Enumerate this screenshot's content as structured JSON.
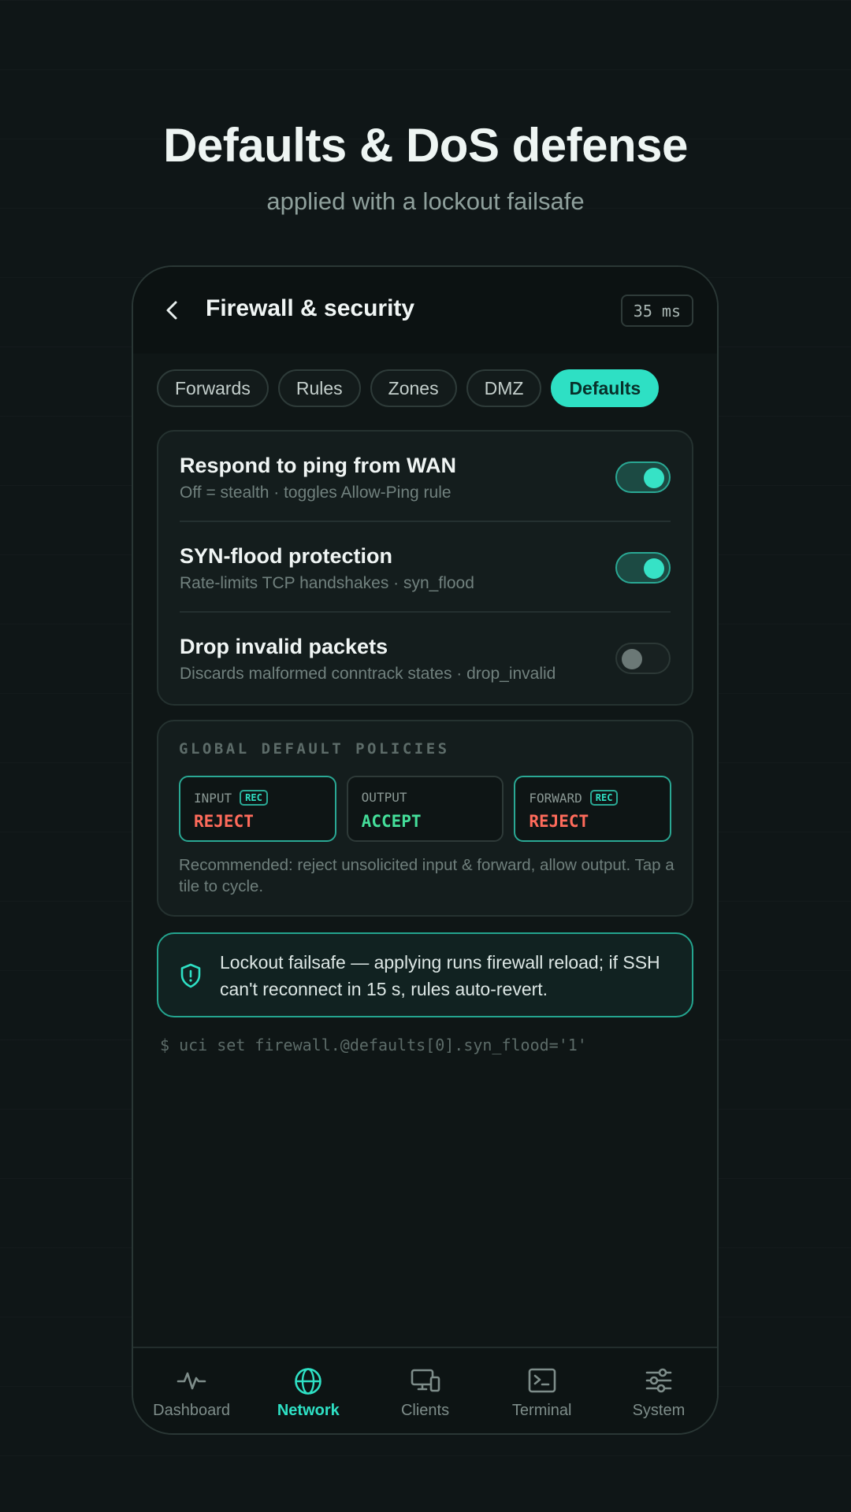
{
  "hero": {
    "title": "Defaults & DoS defense",
    "subtitle": "applied with a lockout failsafe"
  },
  "appbar": {
    "back_icon": "chevron-left-icon",
    "title": "Firewall & security",
    "latency": "35 ms"
  },
  "tabs": [
    {
      "label": "Forwards",
      "active": false
    },
    {
      "label": "Rules",
      "active": false
    },
    {
      "label": "Zones",
      "active": false
    },
    {
      "label": "DMZ",
      "active": false
    },
    {
      "label": "Defaults",
      "active": true
    }
  ],
  "toggles": [
    {
      "title": "Respond to ping from WAN",
      "subtitle": "Off = stealth · toggles Allow-Ping rule",
      "on": true
    },
    {
      "title": "SYN-flood protection",
      "subtitle": "Rate-limits TCP handshakes · syn_flood",
      "on": true
    },
    {
      "title": "Drop invalid packets",
      "subtitle": "Discards malformed conntrack states · drop_invalid",
      "on": false
    }
  ],
  "policies": {
    "title": "GLOBAL DEFAULT POLICIES",
    "tiles": [
      {
        "label": "INPUT",
        "badge": "REC",
        "value": "REJECT"
      },
      {
        "label": "OUTPUT",
        "badge": "",
        "value": "ACCEPT"
      },
      {
        "label": "FORWARD",
        "badge": "REC",
        "value": "REJECT"
      }
    ],
    "note": "Recommended: reject unsolicited input & forward, allow output. Tap a tile to cycle."
  },
  "failsafe": {
    "icon": "shield-alert-icon",
    "text": "Lockout failsafe — applying runs firewall reload; if SSH can't reconnect in 15 s, rules auto-revert."
  },
  "command": "$ uci set firewall.@defaults[0].syn_flood='1'",
  "nav": [
    {
      "label": "Dashboard",
      "icon": "activity-icon",
      "active": false
    },
    {
      "label": "Network",
      "icon": "globe-icon",
      "active": true
    },
    {
      "label": "Clients",
      "icon": "devices-icon",
      "active": false
    },
    {
      "label": "Terminal",
      "icon": "terminal-icon",
      "active": false
    },
    {
      "label": "System",
      "icon": "sliders-icon",
      "active": false
    }
  ],
  "colors": {
    "accent": "#2ee0c4",
    "reject": "#ff6b5b",
    "accept": "#44df9a",
    "background": "#0f1617"
  }
}
